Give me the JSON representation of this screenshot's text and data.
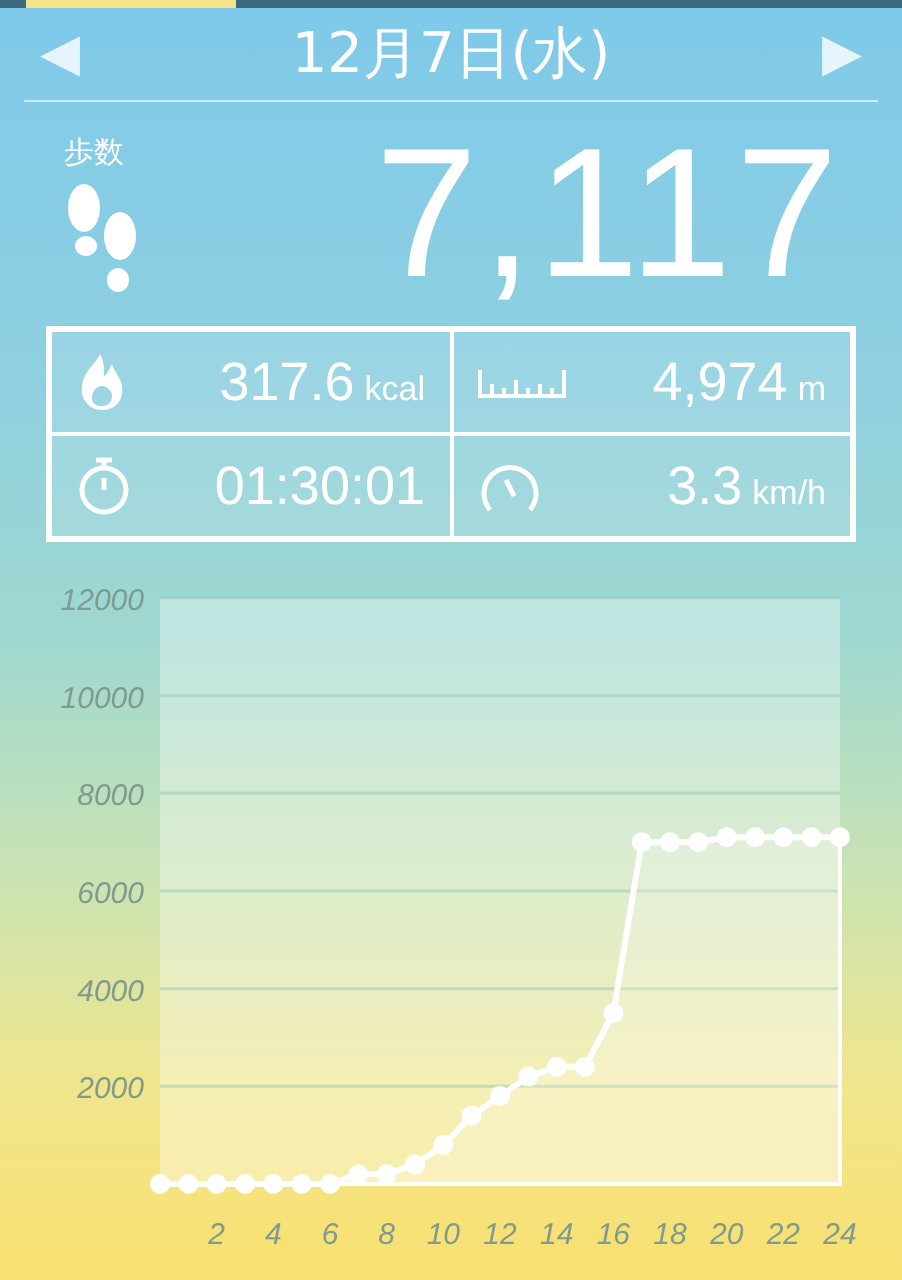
{
  "header": {
    "prev_button": "◀",
    "date": "12月7日(水)",
    "next_button": "▶"
  },
  "steps": {
    "label": "歩数",
    "value": "7,117"
  },
  "stats": [
    {
      "kind": "calories",
      "value": "317.6",
      "unit": "kcal"
    },
    {
      "kind": "distance",
      "value": "4,974",
      "unit": "m"
    },
    {
      "kind": "duration",
      "value": "01:30:01"
    },
    {
      "kind": "speed",
      "value": "3.3",
      "unit": "km/h"
    }
  ],
  "chart_data": {
    "type": "area",
    "grid": true,
    "x": [
      0,
      1,
      2,
      3,
      4,
      5,
      6,
      7,
      8,
      9,
      10,
      11,
      12,
      13,
      14,
      15,
      16,
      17,
      18,
      19,
      20,
      21,
      22,
      23,
      24
    ],
    "values": [
      0,
      0,
      0,
      0,
      0,
      0,
      0,
      200,
      200,
      400,
      800,
      1400,
      1800,
      2200,
      2400,
      2400,
      3500,
      7000,
      7000,
      7000,
      7100,
      7100,
      7100,
      7100,
      7100
    ],
    "xlim": [
      0,
      24
    ],
    "ylim": [
      0,
      12000
    ],
    "xticks": [
      2,
      4,
      6,
      8,
      10,
      12,
      14,
      16,
      18,
      20,
      22,
      24
    ],
    "yticks": [
      2000,
      4000,
      6000,
      8000,
      10000,
      12000
    ]
  }
}
